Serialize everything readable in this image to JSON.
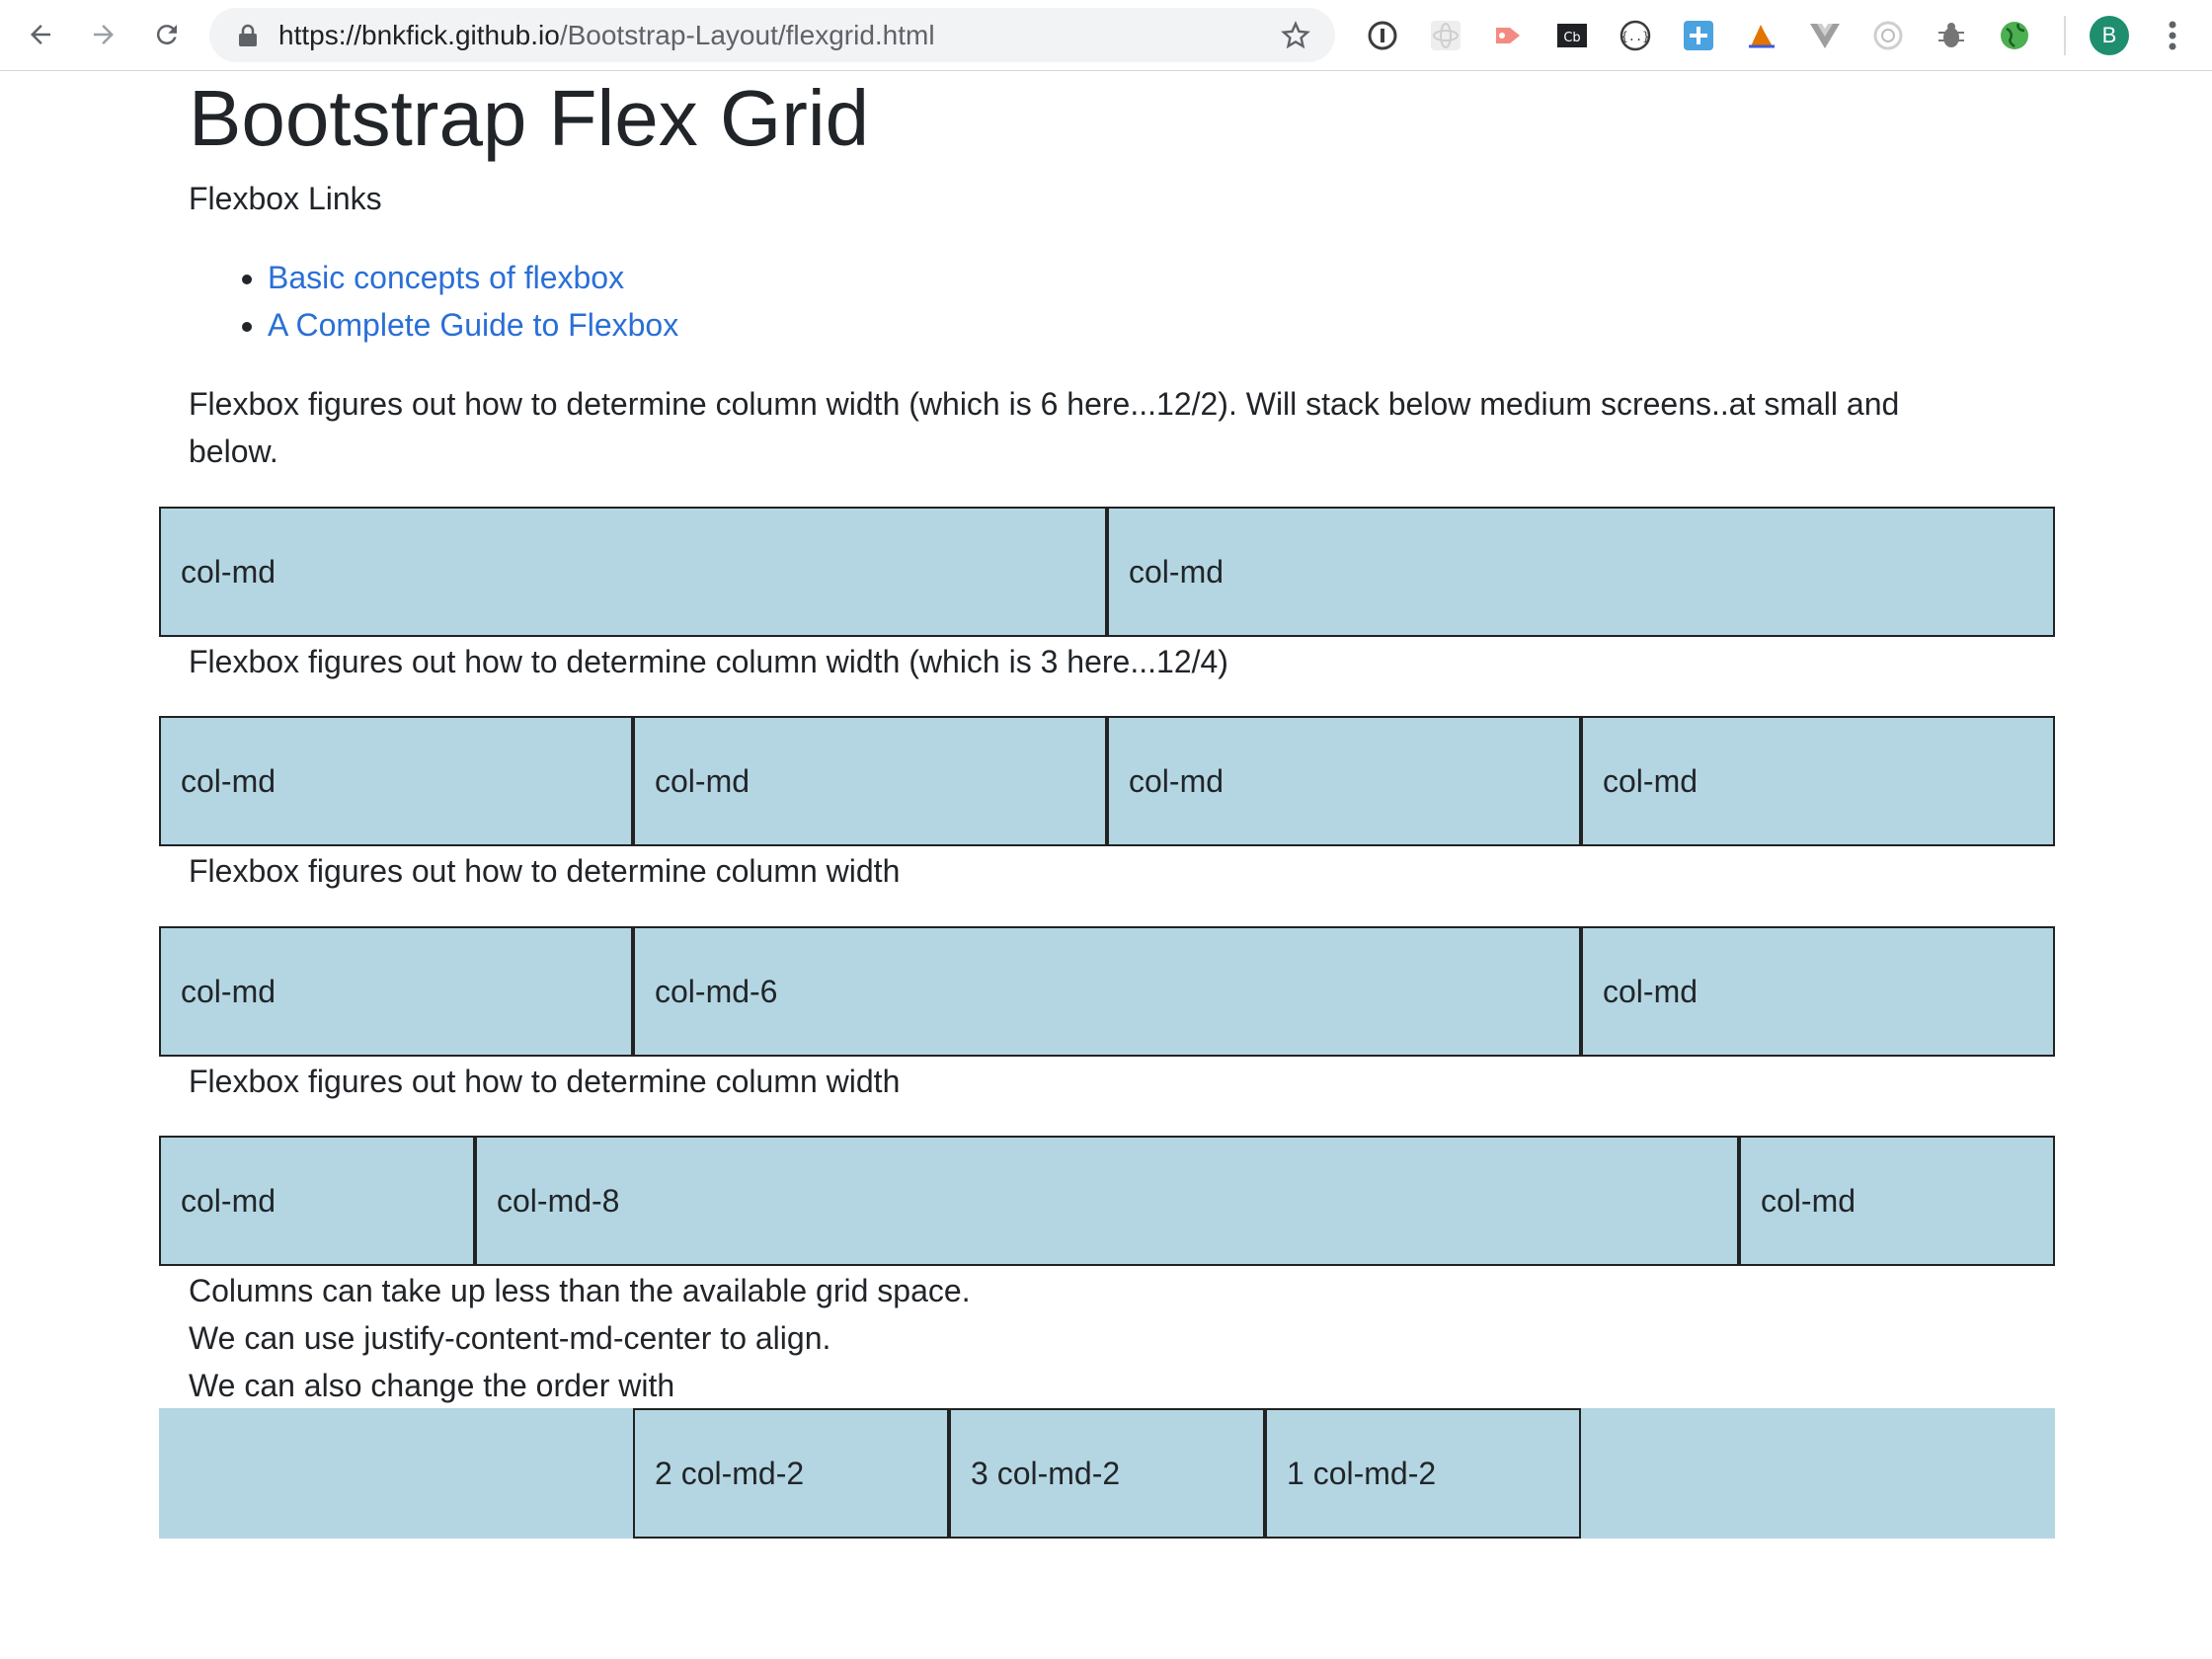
{
  "browser": {
    "url_host": "https://bnkfick.github.io",
    "url_path": "/Bootstrap-Layout/flexgrid.html",
    "profile_initial": "B",
    "extensions": [
      "password-manager-icon",
      "react-devtools-icon",
      "tag-icon",
      "cb-icon",
      "json-viewer-icon",
      "plus-extension-icon",
      "chart-extension-icon",
      "vue-devtools-icon",
      "circle-extension-icon",
      "bug-icon",
      "globe-icon"
    ]
  },
  "page": {
    "title": "Bootstrap Flex Grid",
    "links_heading": "Flexbox Links",
    "links": [
      "Basic concepts of flexbox",
      "A Complete Guide to Flexbox"
    ],
    "para1_line1": "Flexbox figures out how to determine column width (which is 6 here...12/2). Will stack below medium screens..at small and",
    "para1_line2": "below.",
    "row1": [
      "col-md",
      "col-md"
    ],
    "para2": "Flexbox figures out how to determine column width (which is 3 here...12/4)",
    "row2": [
      "col-md",
      "col-md",
      "col-md",
      "col-md"
    ],
    "para3": "Flexbox figures out how to determine column width",
    "row3": [
      "col-md",
      "col-md-6",
      "col-md"
    ],
    "para4": "Flexbox figures out how to determine column width",
    "row4": [
      "col-md",
      "col-md-8",
      "col-md"
    ],
    "para5_line1": "Columns can take up less than the available grid space.",
    "para5_line2": "We can use justify-content-md-center to align.",
    "para5_line3": "We can also change the order with",
    "row5": [
      "2 col-md-2",
      "3 col-md-2",
      "1 col-md-2"
    ]
  },
  "colors": {
    "column_bg": "#b4d6e2",
    "link": "#2a6fd6"
  }
}
